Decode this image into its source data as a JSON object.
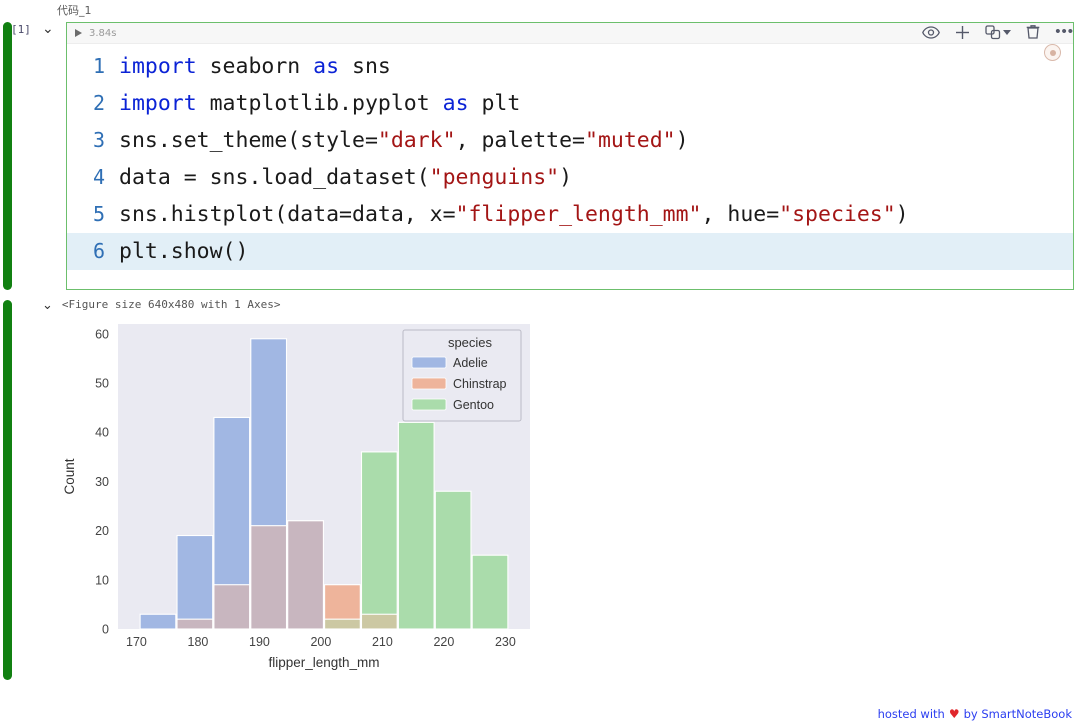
{
  "cell": {
    "name": "代码_1",
    "exec_count": "[1]",
    "run_time": "3.84s",
    "collapse_glyph": "⌄",
    "run_icon": "play-icon",
    "lines": [
      {
        "n": "1",
        "tokens": [
          {
            "t": "import",
            "c": "kw"
          },
          {
            "t": " seaborn ",
            "c": ""
          },
          {
            "t": "as",
            "c": "kw"
          },
          {
            "t": " sns",
            "c": ""
          }
        ]
      },
      {
        "n": "2",
        "tokens": [
          {
            "t": "import",
            "c": "kw"
          },
          {
            "t": " matplotlib.pyplot ",
            "c": ""
          },
          {
            "t": "as",
            "c": "kw"
          },
          {
            "t": " plt",
            "c": ""
          }
        ]
      },
      {
        "n": "3",
        "tokens": [
          {
            "t": "sns.set_theme(style=",
            "c": ""
          },
          {
            "t": "\"dark\"",
            "c": "str"
          },
          {
            "t": ", palette=",
            "c": ""
          },
          {
            "t": "\"muted\"",
            "c": "str"
          },
          {
            "t": ")",
            "c": ""
          }
        ]
      },
      {
        "n": "4",
        "tokens": [
          {
            "t": "data = sns.load_dataset(",
            "c": ""
          },
          {
            "t": "\"penguins\"",
            "c": "str"
          },
          {
            "t": ")",
            "c": ""
          }
        ]
      },
      {
        "n": "5",
        "tokens": [
          {
            "t": "sns.histplot(data=data, x=",
            "c": ""
          },
          {
            "t": "\"flipper_length_mm\"",
            "c": "str"
          },
          {
            "t": ", hue=",
            "c": ""
          },
          {
            "t": "\"species\"",
            "c": "str"
          },
          {
            "t": ")",
            "c": ""
          }
        ]
      },
      {
        "n": "6",
        "tokens": [
          {
            "t": "plt.show()",
            "c": ""
          }
        ],
        "active": true
      }
    ],
    "toolbar": [
      {
        "name": "visibility-eye-icon",
        "label": "eye"
      },
      {
        "name": "add-cell-icon",
        "label": "+"
      },
      {
        "name": "split-cell-icon",
        "label": "split"
      },
      {
        "name": "delete-cell-icon",
        "label": "trash"
      },
      {
        "name": "more-options-icon",
        "label": "..."
      }
    ]
  },
  "output": {
    "collapse_glyph": "⌄",
    "figure_repr": "<Figure size 640x480 with 1 Axes>"
  },
  "footer": {
    "prefix": "hosted with",
    "heart": "♥",
    "suffix": "by SmartNoteBook"
  },
  "chart_data": {
    "type": "bar",
    "subtype": "histogram-overlapping",
    "title": "",
    "xlabel": "flipper_length_mm",
    "ylabel": "Count",
    "xlim": [
      167,
      234
    ],
    "ylim": [
      0,
      62
    ],
    "xticks": [
      170,
      180,
      190,
      200,
      210,
      220,
      230
    ],
    "yticks": [
      0,
      10,
      20,
      30,
      40,
      50,
      60
    ],
    "grid": false,
    "axes_facecolor": "#eaeaf2",
    "legend": {
      "title": "species",
      "position": "upper right",
      "entries": [
        {
          "label": "Adelie",
          "color": "#a1b7e3"
        },
        {
          "label": "Chinstrap",
          "color": "#eeb49b"
        },
        {
          "label": "Gentoo",
          "color": "#aadcab"
        }
      ]
    },
    "bin_edges": [
      170.5,
      176.5,
      182.5,
      188.5,
      194.5,
      200.5,
      206.5,
      212.5,
      218.5,
      224.5,
      230.5,
      236.5
    ],
    "series": [
      {
        "name": "Adelie",
        "color": "#a1b7e3",
        "values": [
          3,
          19,
          43,
          59,
          22,
          0,
          0,
          0,
          0,
          0,
          0
        ]
      },
      {
        "name": "Chinstrap",
        "color": "#eeb49b",
        "values": [
          0,
          2,
          9,
          21,
          22,
          9,
          3,
          0,
          0,
          0,
          0
        ]
      },
      {
        "name": "Gentoo",
        "color": "#aadcab",
        "values": [
          0,
          0,
          0,
          0,
          0,
          2,
          36,
          42,
          28,
          15,
          0
        ]
      }
    ],
    "overlap_color": "#9794b8",
    "overlap_gc_color": "#c4ab6e",
    "overlap_dark_color": "#7f8499"
  }
}
